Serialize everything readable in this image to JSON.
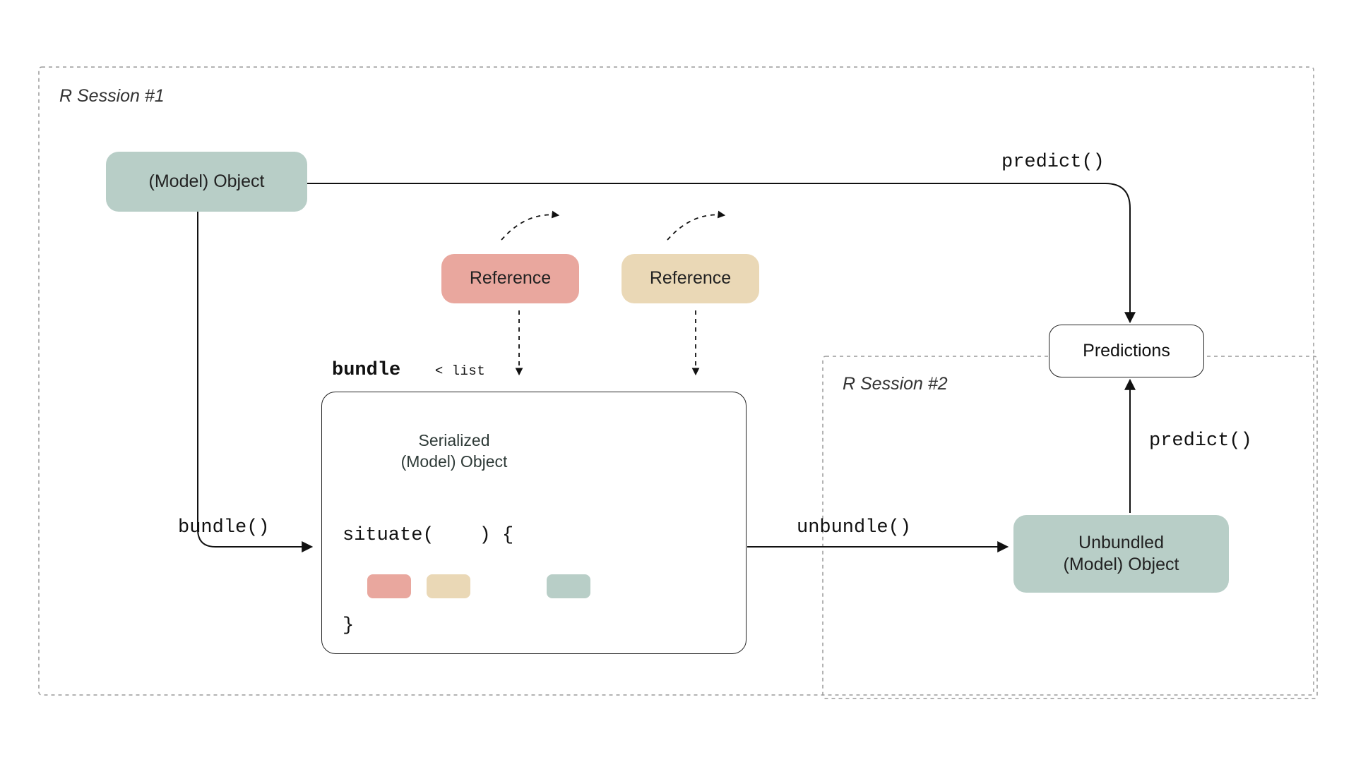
{
  "session1_label": "R Session #1",
  "session2_label": "R Session #2",
  "model_object": "(Model) Object",
  "reference_label_a": "Reference",
  "reference_label_b": "Reference",
  "bundle_title_kw": "bundle",
  "bundle_title_sub": "< list",
  "serialized_line1": "Serialized",
  "serialized_line2": "(Model) Object",
  "situate_kw": "situate(",
  "situate_after": ") {",
  "brace_close": "}",
  "bundle_fn": "bundle()",
  "unbundle_fn": "unbundle()",
  "predict_fn": "predict()",
  "predictions": "Predictions",
  "unbundled_line1": "Unbundled",
  "unbundled_line2": "(Model) Object",
  "colors": {
    "teal": "#b8cec7",
    "red": "#e9a79e",
    "tan": "#ead8b6",
    "hatch_light": "#e4eeea",
    "hatch_dark": "#b8cec7",
    "gray_hatch_light": "#f3f3f3",
    "gray_hatch_dark": "#d6d6d6",
    "border_gray": "#9a9a9a"
  }
}
